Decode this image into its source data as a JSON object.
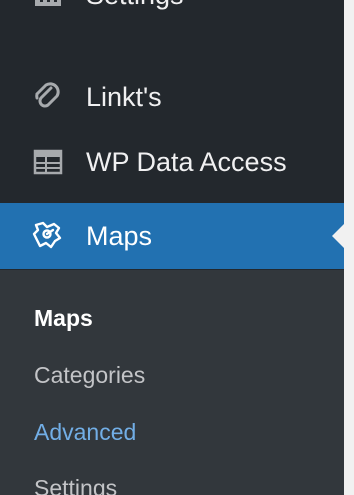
{
  "colors": {
    "sidebar_bg": "#23282d",
    "submenu_bg": "#32373c",
    "current_bg": "#2271b1",
    "link_hover": "#72aee6",
    "content_bg": "#f1f1f1"
  },
  "menu": {
    "items": [
      {
        "label": "Settings",
        "icon": "settings-icon"
      },
      {
        "label": "Linkt's",
        "icon": "link-icon"
      },
      {
        "label": "WP Data Access",
        "icon": "table-icon"
      },
      {
        "label": "Maps",
        "icon": "maps-plugin-icon",
        "current": true
      }
    ]
  },
  "submenu": {
    "items": [
      {
        "label": "Maps",
        "state": "current"
      },
      {
        "label": "Categories",
        "state": "normal"
      },
      {
        "label": "Advanced",
        "state": "hover"
      },
      {
        "label": "Settings",
        "state": "normal"
      }
    ]
  }
}
